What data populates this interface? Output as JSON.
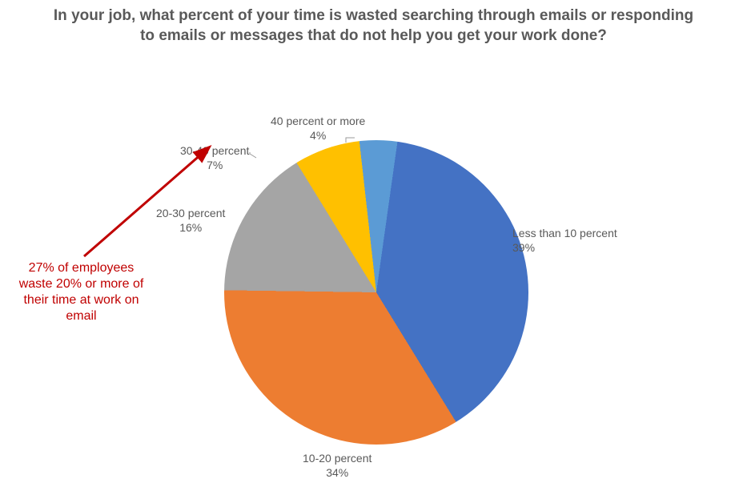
{
  "chart_data": {
    "type": "pie",
    "title": "In your job, what percent of your time is wasted searching through emails or responding to emails or messages that do not help you get your work done?",
    "series": [
      {
        "name": "Less than 10 percent",
        "value": 39,
        "label_pct": "39%",
        "color": "#4472c4"
      },
      {
        "name": "10-20 percent",
        "value": 34,
        "label_pct": "34%",
        "color": "#ed7d31"
      },
      {
        "name": "20-30 percent",
        "value": 16,
        "label_pct": "16%",
        "color": "#a5a5a5"
      },
      {
        "name": "30-40 percent",
        "value": 7,
        "label_pct": "7%",
        "color": "#ffc000"
      },
      {
        "name": "40 percent or more",
        "value": 4,
        "label_pct": "4%",
        "color": "#5b9bd5"
      }
    ],
    "annotation": {
      "text": "27% of employees waste 20% or more of their time at work on email",
      "color": "#c00000"
    }
  }
}
